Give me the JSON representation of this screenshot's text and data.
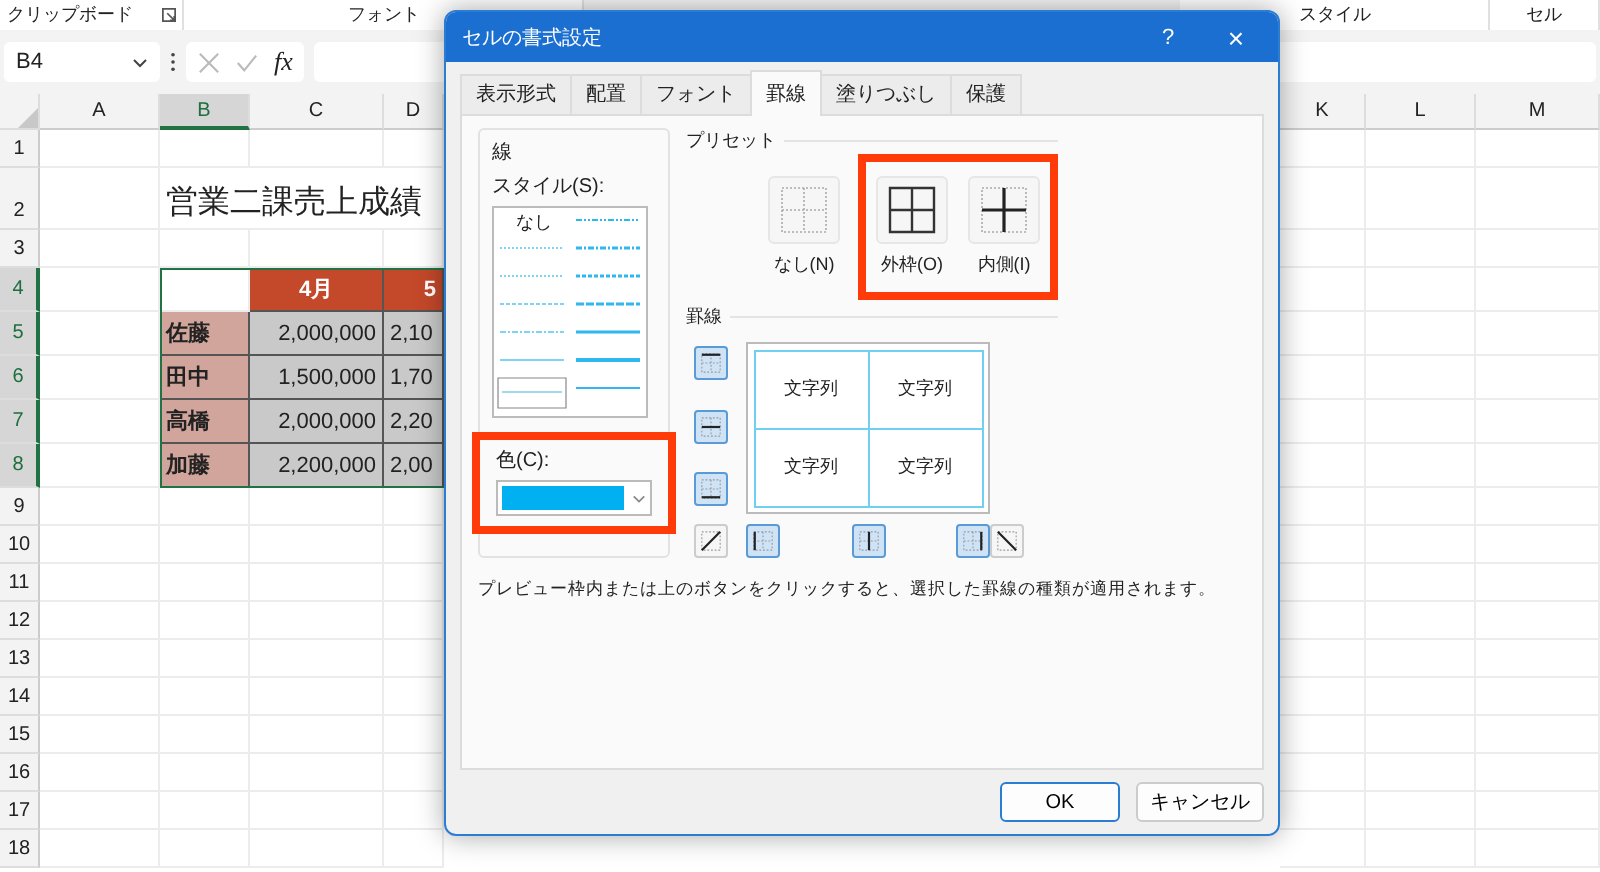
{
  "ribbon_groups": [
    {
      "label": "クリップボード",
      "launcher": true
    },
    {
      "label": "フォント",
      "launcher": false
    },
    {
      "label": "スタイル",
      "launcher": false
    },
    {
      "label": "セル",
      "launcher": false
    }
  ],
  "formula_bar": {
    "name_box": "B4",
    "function_label": "fx"
  },
  "column_headers": [
    {
      "label": "A",
      "selected": false
    },
    {
      "label": "B",
      "selected": true
    },
    {
      "label": "C",
      "selected": false
    },
    {
      "label": "D",
      "selected": false
    },
    {
      "label": "K",
      "selected": false
    },
    {
      "label": "L",
      "selected": false
    },
    {
      "label": "M",
      "selected": false
    }
  ],
  "rows": [
    {
      "number": "1",
      "selected": false
    },
    {
      "number": "2",
      "selected": false,
      "cells": [
        {
          "kind": "title",
          "text": "営業二課売上成績"
        }
      ]
    },
    {
      "number": "3",
      "selected": false
    },
    {
      "number": "4",
      "selected": true,
      "cells": [
        {
          "kind": "blank"
        },
        {
          "kind": "header",
          "text": "4月"
        },
        {
          "kind": "header",
          "text": "5"
        }
      ]
    },
    {
      "number": "5",
      "selected": true,
      "cells": [
        {
          "kind": "name",
          "text": "佐藤"
        },
        {
          "kind": "value",
          "text": "2,000,000"
        },
        {
          "kind": "value",
          "text": "2,10"
        }
      ]
    },
    {
      "number": "6",
      "selected": true,
      "cells": [
        {
          "kind": "name",
          "text": "田中"
        },
        {
          "kind": "value",
          "text": "1,500,000"
        },
        {
          "kind": "value",
          "text": "1,70"
        }
      ]
    },
    {
      "number": "7",
      "selected": true,
      "cells": [
        {
          "kind": "name",
          "text": "高橋"
        },
        {
          "kind": "value",
          "text": "2,000,000"
        },
        {
          "kind": "value",
          "text": "2,20"
        }
      ]
    },
    {
      "number": "8",
      "selected": true,
      "cells": [
        {
          "kind": "name",
          "text": "加藤"
        },
        {
          "kind": "value",
          "text": "2,200,000"
        },
        {
          "kind": "value",
          "text": "2,00"
        }
      ]
    },
    {
      "number": "9",
      "selected": false
    },
    {
      "number": "10",
      "selected": false
    },
    {
      "number": "11",
      "selected": false
    },
    {
      "number": "12",
      "selected": false
    },
    {
      "number": "13",
      "selected": false
    },
    {
      "number": "14",
      "selected": false
    },
    {
      "number": "15",
      "selected": false
    },
    {
      "number": "16",
      "selected": false
    },
    {
      "number": "17",
      "selected": false
    },
    {
      "number": "18",
      "selected": false
    }
  ],
  "dialog": {
    "title": "セルの書式設定",
    "help": "?",
    "close": "×",
    "tabs": [
      {
        "label": "表示形式",
        "selected": false
      },
      {
        "label": "配置",
        "selected": false
      },
      {
        "label": "フォント",
        "selected": false
      },
      {
        "label": "罫線",
        "selected": true
      },
      {
        "label": "塗りつぶし",
        "selected": false
      },
      {
        "label": "保護",
        "selected": false
      }
    ],
    "line_group": {
      "title": "線",
      "style_label": "スタイル(S):",
      "none_label": "なし",
      "color_label": "色(C):",
      "color": "#00b0f0",
      "highlighted": true
    },
    "presets": {
      "title": "プリセット",
      "items": [
        {
          "label": "なし(N)",
          "kind": "none",
          "highlighted": false
        },
        {
          "label": "外枠(O)",
          "kind": "outline",
          "highlighted": true
        },
        {
          "label": "内側(I)",
          "kind": "inside",
          "highlighted": true
        }
      ]
    },
    "border": {
      "title": "罫線",
      "buttons": [
        {
          "kind": "top",
          "on": true
        },
        {
          "kind": "middle-h",
          "on": true
        },
        {
          "kind": "bottom",
          "on": true
        },
        {
          "kind": "diag-up",
          "on": false
        },
        {
          "kind": "left",
          "on": true
        },
        {
          "kind": "middle-v",
          "on": true
        },
        {
          "kind": "right",
          "on": true
        },
        {
          "kind": "diag-down",
          "on": false
        }
      ],
      "preview_texts": [
        "文字列",
        "文字列",
        "文字列",
        "文字列"
      ]
    },
    "description": "プレビュー枠内または上のボタンをクリックすると、選択した罫線の種類が適用されます。",
    "buttons": [
      {
        "label": "OK",
        "default": true
      },
      {
        "label": "キャンセル",
        "default": false
      }
    ]
  }
}
